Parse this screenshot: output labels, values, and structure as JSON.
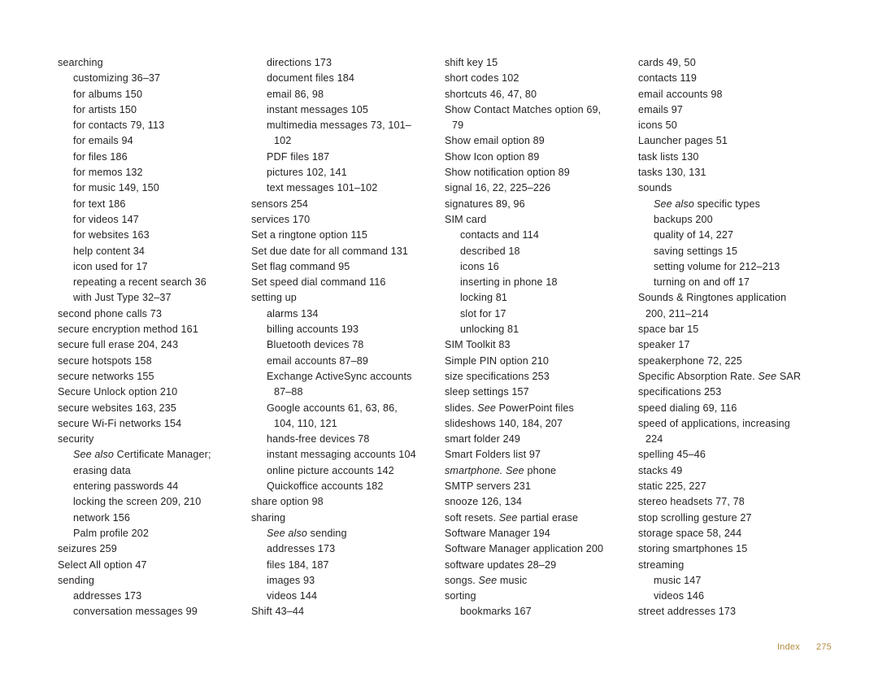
{
  "page": {
    "footer_label": "Index",
    "footer_number": "275",
    "footer_color": "#b38b3f"
  },
  "columns": [
    {
      "entries": [
        {
          "level": 0,
          "text": "searching"
        },
        {
          "level": 1,
          "text": "customizing 36–37"
        },
        {
          "level": 1,
          "text": "for albums 150"
        },
        {
          "level": 1,
          "text": "for artists 150"
        },
        {
          "level": 1,
          "text": "for contacts 79, 113"
        },
        {
          "level": 1,
          "text": "for emails 94"
        },
        {
          "level": 1,
          "text": "for files 186"
        },
        {
          "level": 1,
          "text": "for memos 132"
        },
        {
          "level": 1,
          "text": "for music 149, 150"
        },
        {
          "level": 1,
          "text": "for text 186"
        },
        {
          "level": 1,
          "text": "for videos 147"
        },
        {
          "level": 1,
          "text": "for websites 163"
        },
        {
          "level": 1,
          "text": "help content 34"
        },
        {
          "level": 1,
          "text": "icon used for 17"
        },
        {
          "level": 1,
          "text": "repeating a recent search 36"
        },
        {
          "level": 1,
          "text": "with Just Type 32–37"
        },
        {
          "level": 0,
          "text": "second phone calls 73"
        },
        {
          "level": 0,
          "text": "secure encryption method 161"
        },
        {
          "level": 0,
          "text": "secure full erase 204, 243"
        },
        {
          "level": 0,
          "text": "secure hotspots 158"
        },
        {
          "level": 0,
          "text": "secure networks 155"
        },
        {
          "level": 0,
          "text": "Secure Unlock option 210"
        },
        {
          "level": 0,
          "text": "secure websites 163, 235"
        },
        {
          "level": 0,
          "text": "secure Wi-Fi networks 154"
        },
        {
          "level": 0,
          "text": "security"
        },
        {
          "level": 1,
          "italic_prefix": "See also",
          "text": " Certificate Manager;"
        },
        {
          "level": 1,
          "text": "erasing data",
          "hang": true
        },
        {
          "level": 1,
          "text": "entering passwords 44"
        },
        {
          "level": 1,
          "text": "locking the screen 209, 210"
        },
        {
          "level": 1,
          "text": "network 156"
        },
        {
          "level": 1,
          "text": "Palm profile 202"
        },
        {
          "level": 0,
          "text": "seizures 259"
        },
        {
          "level": 0,
          "text": "Select All option 47"
        },
        {
          "level": 0,
          "text": "sending"
        },
        {
          "level": 1,
          "text": "addresses 173"
        },
        {
          "level": 1,
          "text": "conversation messages 99"
        }
      ]
    },
    {
      "entries": [
        {
          "level": 1,
          "text": "directions 173"
        },
        {
          "level": 1,
          "text": "document files 184"
        },
        {
          "level": 1,
          "text": "email 86, 98"
        },
        {
          "level": 1,
          "text": "instant messages 105"
        },
        {
          "level": 1,
          "text": "multimedia messages 73, 101–"
        },
        {
          "level": 1,
          "text": "102",
          "extra_indent": true
        },
        {
          "level": 1,
          "text": "PDF files 187"
        },
        {
          "level": 1,
          "text": "pictures 102, 141"
        },
        {
          "level": 1,
          "text": "text messages 101–102"
        },
        {
          "level": 0,
          "text": "sensors 254"
        },
        {
          "level": 0,
          "text": "services 170"
        },
        {
          "level": 0,
          "text": "Set a ringtone option 115"
        },
        {
          "level": 0,
          "text": "Set due date for all command 131"
        },
        {
          "level": 0,
          "text": "Set flag command 95"
        },
        {
          "level": 0,
          "text": "Set speed dial command 116"
        },
        {
          "level": 0,
          "text": "setting up"
        },
        {
          "level": 1,
          "text": "alarms 134"
        },
        {
          "level": 1,
          "text": "billing accounts 193"
        },
        {
          "level": 1,
          "text": "Bluetooth devices 78"
        },
        {
          "level": 1,
          "text": "email accounts 87–89"
        },
        {
          "level": 1,
          "text": "Exchange ActiveSync accounts"
        },
        {
          "level": 1,
          "text": "87–88",
          "extra_indent": true
        },
        {
          "level": 1,
          "text": "Google accounts 61, 63, 86,"
        },
        {
          "level": 1,
          "text": "104, 110, 121",
          "extra_indent": true
        },
        {
          "level": 1,
          "text": "hands-free devices 78"
        },
        {
          "level": 1,
          "text": "instant messaging accounts 104"
        },
        {
          "level": 1,
          "text": "online picture accounts 142"
        },
        {
          "level": 1,
          "text": "Quickoffice accounts 182"
        },
        {
          "level": 0,
          "text": "share option 98"
        },
        {
          "level": 0,
          "text": "sharing"
        },
        {
          "level": 1,
          "italic_prefix": "See also",
          "text": " sending"
        },
        {
          "level": 1,
          "text": "addresses 173"
        },
        {
          "level": 1,
          "text": "files 184, 187"
        },
        {
          "level": 1,
          "text": "images 93"
        },
        {
          "level": 1,
          "text": "videos 144"
        },
        {
          "level": 0,
          "text": "Shift 43–44"
        }
      ]
    },
    {
      "entries": [
        {
          "level": 0,
          "text": "shift key 15"
        },
        {
          "level": 0,
          "text": "short codes 102"
        },
        {
          "level": 0,
          "text": "shortcuts 46, 47, 80"
        },
        {
          "level": 0,
          "text": "Show Contact Matches option 69,"
        },
        {
          "level": 0,
          "text": "79",
          "extra_indent": true
        },
        {
          "level": 0,
          "text": "Show email option 89"
        },
        {
          "level": 0,
          "text": "Show Icon option 89"
        },
        {
          "level": 0,
          "text": "Show notification option 89"
        },
        {
          "level": 0,
          "text": "signal 16, 22, 225–226"
        },
        {
          "level": 0,
          "text": "signatures 89, 96"
        },
        {
          "level": 0,
          "text": "SIM card"
        },
        {
          "level": 1,
          "text": "contacts and 114"
        },
        {
          "level": 1,
          "text": "described 18"
        },
        {
          "level": 1,
          "text": "icons 16"
        },
        {
          "level": 1,
          "text": "inserting in phone 18"
        },
        {
          "level": 1,
          "text": "locking 81"
        },
        {
          "level": 1,
          "text": "slot for 17"
        },
        {
          "level": 1,
          "text": "unlocking 81"
        },
        {
          "level": 0,
          "text": "SIM Toolkit 83"
        },
        {
          "level": 0,
          "text": "Simple PIN option 210"
        },
        {
          "level": 0,
          "text": "size specifications 253"
        },
        {
          "level": 0,
          "text": "sleep settings 157"
        },
        {
          "level": 0,
          "text": "slides. ",
          "italic_suffix": "See ",
          "text_after": "PowerPoint files"
        },
        {
          "level": 0,
          "text": "slideshows 140, 184, 207"
        },
        {
          "level": 0,
          "text": "smart folder 249"
        },
        {
          "level": 0,
          "text": "Smart Folders list 97"
        },
        {
          "level": 0,
          "italic_lead": "smartphone. See ",
          "text": "phone"
        },
        {
          "level": 0,
          "text": "SMTP servers 231"
        },
        {
          "level": 0,
          "text": "snooze 126, 134"
        },
        {
          "level": 0,
          "text": "soft resets. ",
          "italic_mid": "See ",
          "text_after": "partial erase"
        },
        {
          "level": 0,
          "text": "Software Manager 194"
        },
        {
          "level": 0,
          "text": "Software Manager application 200"
        },
        {
          "level": 0,
          "text": "software updates 28–29"
        },
        {
          "level": 0,
          "text": "songs. ",
          "italic_mid2": "See ",
          "text_after": "music"
        },
        {
          "level": 0,
          "text": "sorting"
        },
        {
          "level": 1,
          "text": "bookmarks 167"
        }
      ]
    },
    {
      "entries": [
        {
          "level": 0,
          "text": "cards 49, 50"
        },
        {
          "level": 0,
          "text": "contacts 119"
        },
        {
          "level": 0,
          "text": "email accounts 98"
        },
        {
          "level": 0,
          "text": "emails 97"
        },
        {
          "level": 0,
          "text": "icons 50"
        },
        {
          "level": 0,
          "text": "Launcher pages 51"
        },
        {
          "level": 0,
          "text": "task lists 130"
        },
        {
          "level": 0,
          "text": "tasks 130, 131"
        },
        {
          "level": 0,
          "text": "sounds"
        },
        {
          "level": 1,
          "italic_prefix": "See also",
          "text": " specific types"
        },
        {
          "level": 1,
          "text": "backups 200"
        },
        {
          "level": 1,
          "text": "quality of 14, 227"
        },
        {
          "level": 1,
          "text": "saving settings 15"
        },
        {
          "level": 1,
          "text": "setting volume for 212–213"
        },
        {
          "level": 1,
          "text": "turning on and off 17"
        },
        {
          "level": 0,
          "text": "Sounds & Ringtones application"
        },
        {
          "level": 0,
          "text": "200, 211–214",
          "extra_indent": true
        },
        {
          "level": 0,
          "text": "space bar 15"
        },
        {
          "level": 0,
          "text": "speaker 17"
        },
        {
          "level": 0,
          "text": "speakerphone 72, 225"
        },
        {
          "level": 0,
          "text": "Specific Absorption Rate. ",
          "italic_mid3": "See ",
          "text_after": "SAR"
        },
        {
          "level": 0,
          "text": "specifications 253"
        },
        {
          "level": 0,
          "text": "speed dialing 69, 116"
        },
        {
          "level": 0,
          "text": "speed of applications, increasing"
        },
        {
          "level": 0,
          "text": "224",
          "extra_indent": true
        },
        {
          "level": 0,
          "text": "spelling 45–46"
        },
        {
          "level": 0,
          "text": "stacks 49"
        },
        {
          "level": 0,
          "text": "static 225, 227"
        },
        {
          "level": 0,
          "text": "stereo headsets 77, 78"
        },
        {
          "level": 0,
          "text": "stop scrolling gesture 27"
        },
        {
          "level": 0,
          "text": "storage space 58, 244"
        },
        {
          "level": 0,
          "text": "storing smartphones 15"
        },
        {
          "level": 0,
          "text": "streaming"
        },
        {
          "level": 1,
          "text": "music 147"
        },
        {
          "level": 1,
          "text": "videos 146"
        },
        {
          "level": 0,
          "text": "street addresses 173"
        }
      ]
    }
  ]
}
